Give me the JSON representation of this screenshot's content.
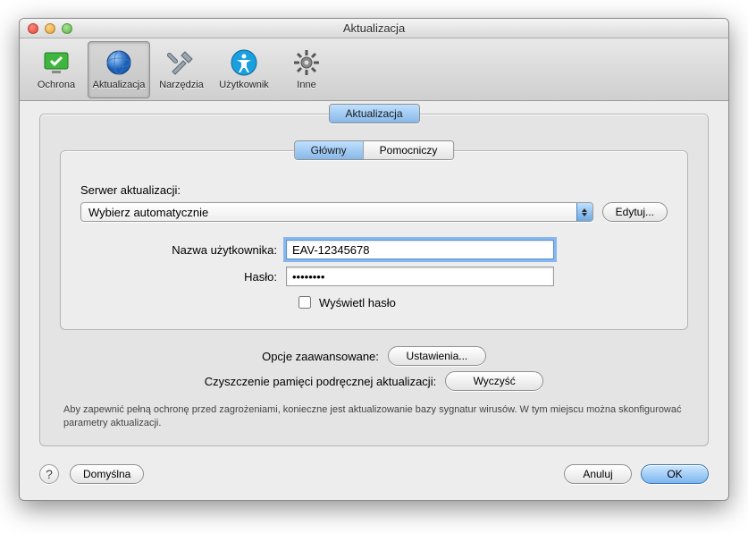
{
  "window": {
    "title": "Aktualizacja"
  },
  "toolbar": {
    "items": [
      {
        "label": "Ochrona"
      },
      {
        "label": "Aktualizacja"
      },
      {
        "label": "Narzędzia"
      },
      {
        "label": "Użytkownik"
      },
      {
        "label": "Inne"
      }
    ]
  },
  "outerTab": {
    "label": "Aktualizacja"
  },
  "innerTabs": {
    "primary": "Główny",
    "secondary": "Pomocniczy"
  },
  "serverSection": {
    "label": "Serwer aktualizacji:",
    "selected": "Wybierz automatycznie",
    "editButton": "Edytuj..."
  },
  "credentials": {
    "usernameLabel": "Nazwa użytkownika:",
    "usernameValue": "EAV-12345678",
    "passwordLabel": "Hasło:",
    "passwordValue": "••••••••",
    "showPasswordLabel": "Wyświetl hasło"
  },
  "advanced": {
    "optionsLabel": "Opcje zaawansowane:",
    "optionsButton": "Ustawienia...",
    "cacheLabel": "Czyszczenie pamięci podręcznej aktualizacji:",
    "cacheButton": "Wyczyść"
  },
  "helpText": "Aby zapewnić pełną ochronę przed zagrożeniami, konieczne jest aktualizowanie bazy sygnatur wirusów. W tym miejscu można skonfigurować parametry aktualizacji.",
  "footer": {
    "default": "Domyślna",
    "cancel": "Anuluj",
    "ok": "OK",
    "helpGlyph": "?"
  }
}
